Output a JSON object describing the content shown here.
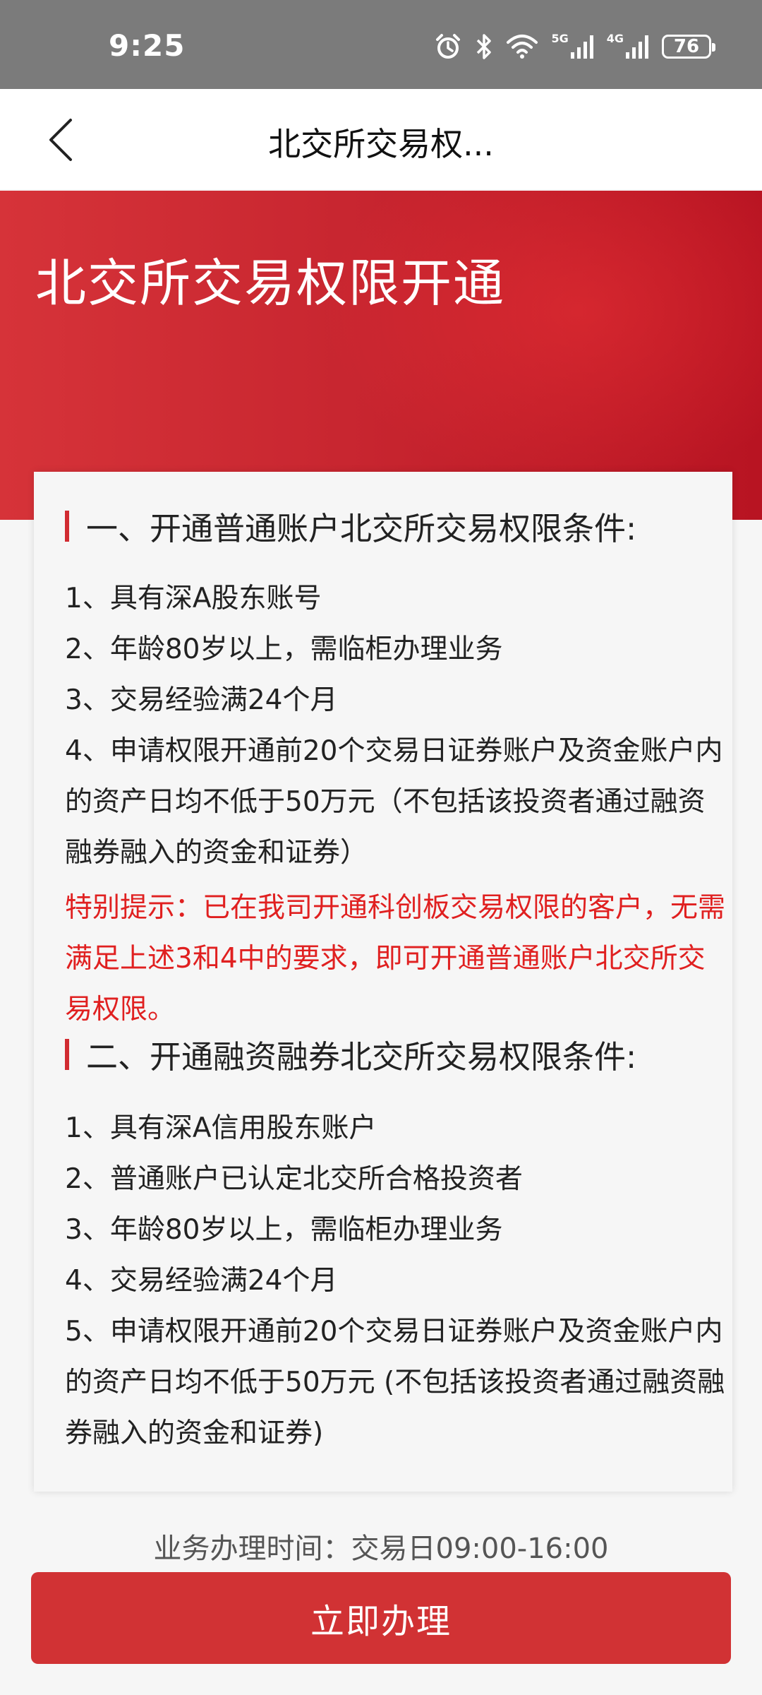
{
  "status_bar": {
    "time": "9:25",
    "network_5g": "5G",
    "network_4g": "4G",
    "battery": "76",
    "icons": [
      "alarm-icon",
      "bluetooth-icon",
      "wifi-icon",
      "signal-icon",
      "signal-icon",
      "battery-icon"
    ]
  },
  "nav": {
    "title": "北交所交易权...",
    "back_icon": "chevron-left-icon"
  },
  "banner": {
    "title": "北交所交易权限开通"
  },
  "section1": {
    "title": "一、开通普通账户北交所交易权限条件:",
    "items": [
      "1、具有深A股东账号",
      "2、年龄80岁以上，需临柜办理业务",
      "3、交易经验满24个月",
      "4、申请权限开通前20个交易日证券账户及资金账户内的资产日均不低于50万元（不包括该投资者通过融资融券融入的资金和证券）"
    ],
    "tip": "特别提示：已在我司开通科创板交易权限的客户，无需满足上述3和4中的要求，即可开通普通账户北交所交易权限。"
  },
  "section2": {
    "title": "二、开通融资融券北交所交易权限条件:",
    "items": [
      "1、具有深A信用股东账户",
      "2、普通账户已认定北交所合格投资者",
      "3、年龄80岁以上，需临柜办理业务",
      "4、交易经验满24个月",
      "5、申请权限开通前20个交易日证券账户及资金账户内的资产日均不低于50万元 (不包括该投资者通过融资融券融入的资金和证券)"
    ]
  },
  "footer": {
    "hours": "业务办理时间：交易日09:00-16:00",
    "cta": "立即办理"
  },
  "colors": {
    "accent": "#d13234",
    "tip": "#e02020",
    "status_bar": "#7b7b7b"
  }
}
